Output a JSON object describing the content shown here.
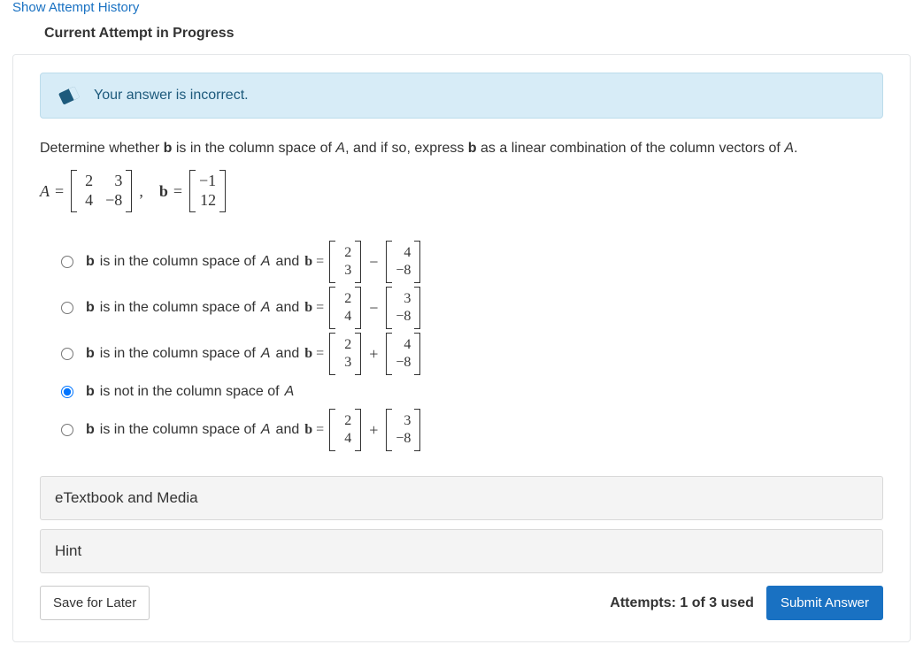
{
  "header": {
    "history_link": "Show Attempt History",
    "current_title": "Current Attempt in Progress"
  },
  "alert": {
    "message": "Your answer is incorrect."
  },
  "question": {
    "prompt_pre": "Determine whether ",
    "prompt_b1": "b",
    "prompt_mid1": " is in the column space of ",
    "prompt_A1": "A",
    "prompt_mid2": ", and if so, express ",
    "prompt_b2": "b",
    "prompt_mid3": " as a linear combination of the column vectors of ",
    "prompt_A2": "A",
    "prompt_end": ".",
    "A_label": "A",
    "b_label": "b",
    "equals": "=",
    "comma": ",",
    "matrix_A": {
      "r1c1": "2",
      "r1c2": "3",
      "r2c1": "4",
      "r2c2": "−8"
    },
    "vector_b": {
      "r1": "−1",
      "r2": "12"
    }
  },
  "options": {
    "common_prefix_b": "b",
    "common_prefix_text": " is in the column space of ",
    "common_prefix_A": "A",
    "common_and": " and ",
    "common_b_eq": "b",
    "equals": " =",
    "v1a": {
      "r1": "2",
      "r2": "3"
    },
    "v1b": {
      "r1": "4",
      "r2": "−8"
    },
    "v2a": {
      "r1": "2",
      "r2": "4"
    },
    "v2b": {
      "r1": "3",
      "r2": "−8"
    },
    "op_minus": "−",
    "op_plus": "+",
    "not_in_text_b": "b",
    "not_in_text_rest": " is not in the column space of ",
    "not_in_text_A": "A"
  },
  "accordions": {
    "etextbook": "eTextbook and Media",
    "hint": "Hint"
  },
  "footer": {
    "save": "Save for Later",
    "attempts": "Attempts: 1 of 3 used",
    "submit": "Submit Answer"
  }
}
